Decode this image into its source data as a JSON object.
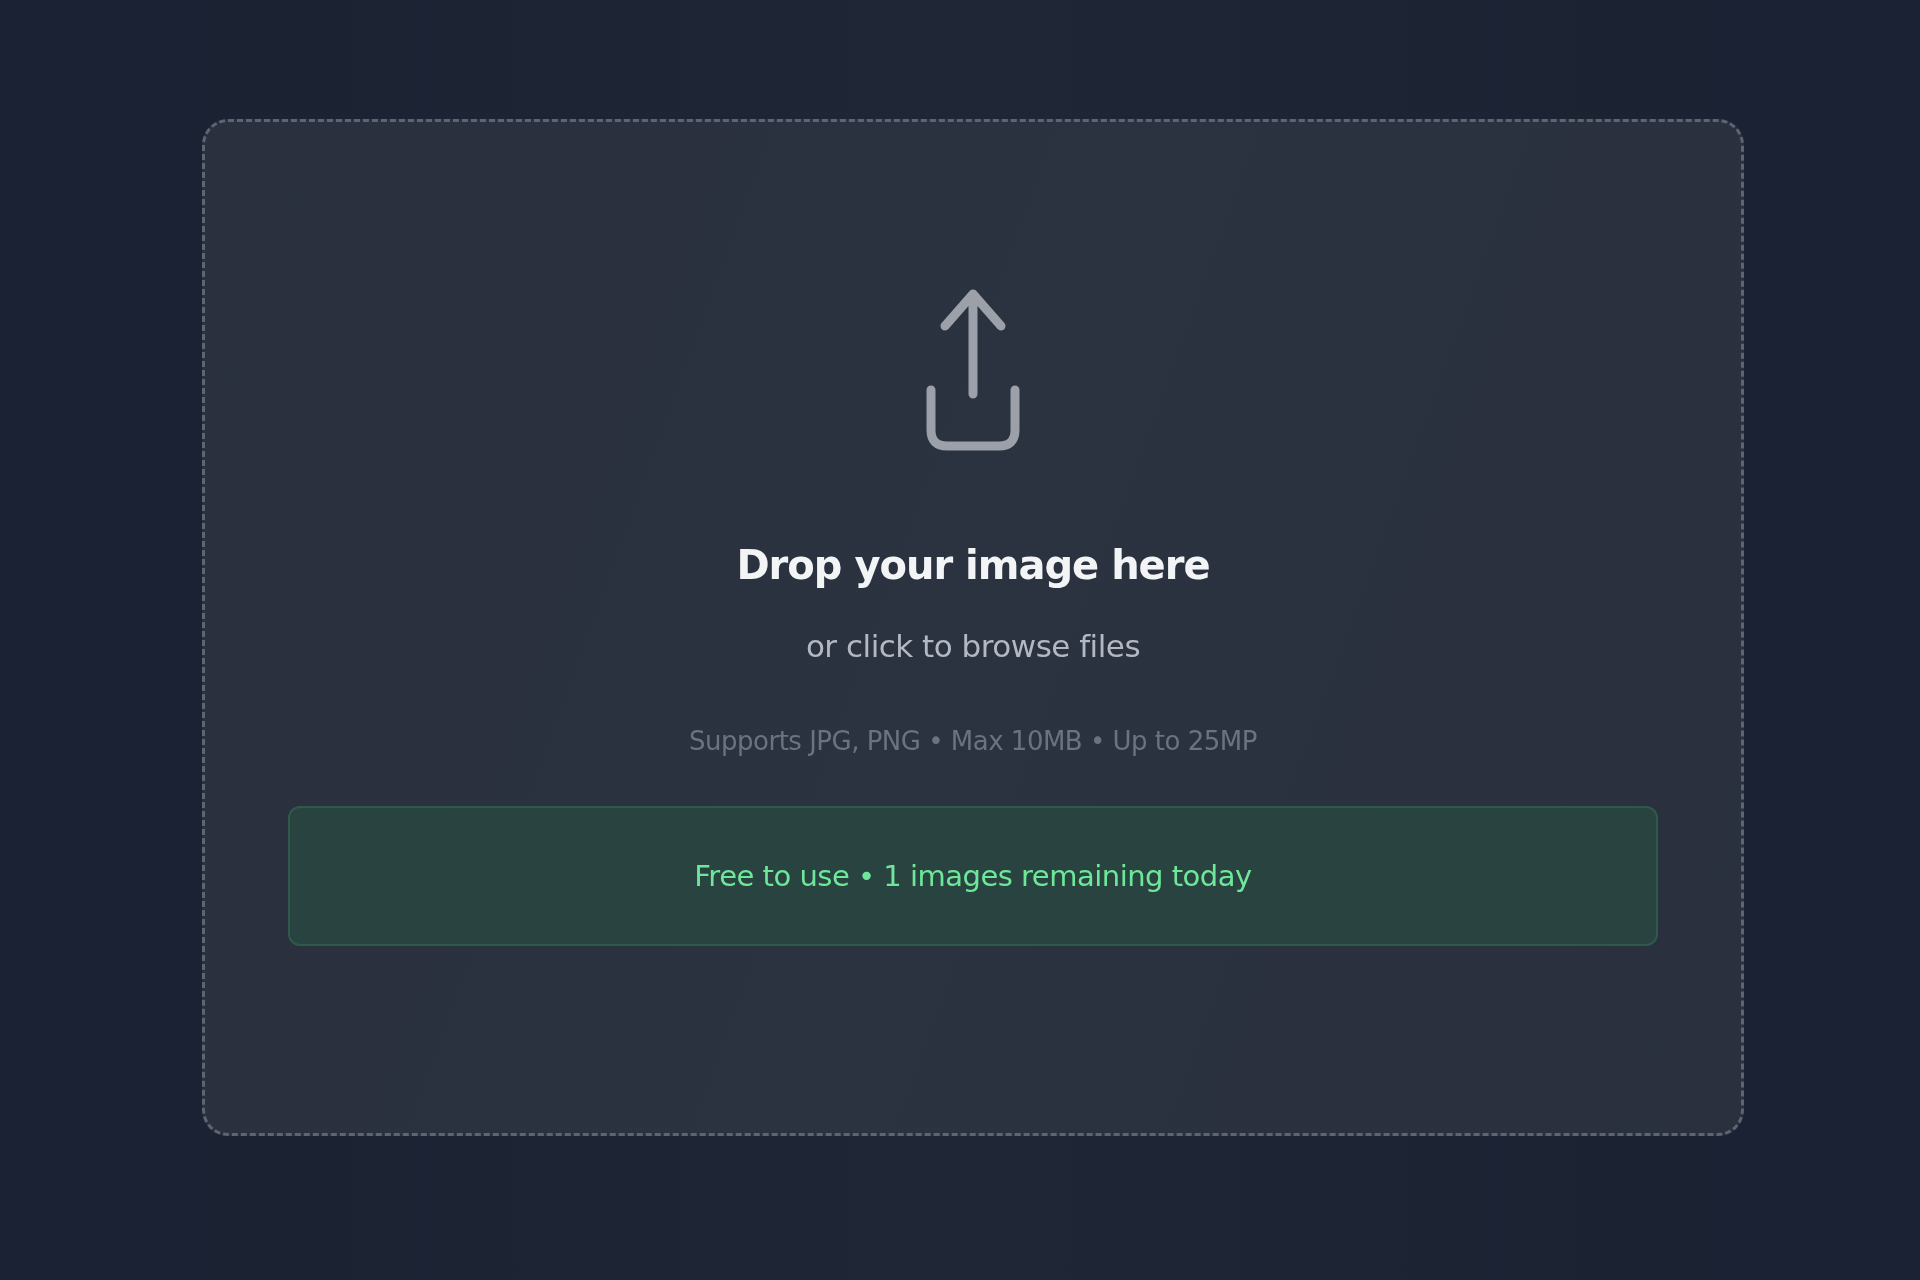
{
  "upload": {
    "title": "Drop your image here",
    "subtitle": "or click to browse files",
    "formats": "Supports JPG, PNG • Max 10MB • Up to 25MP"
  },
  "notice": {
    "text": "Free to use • 1 images remaining today"
  }
}
